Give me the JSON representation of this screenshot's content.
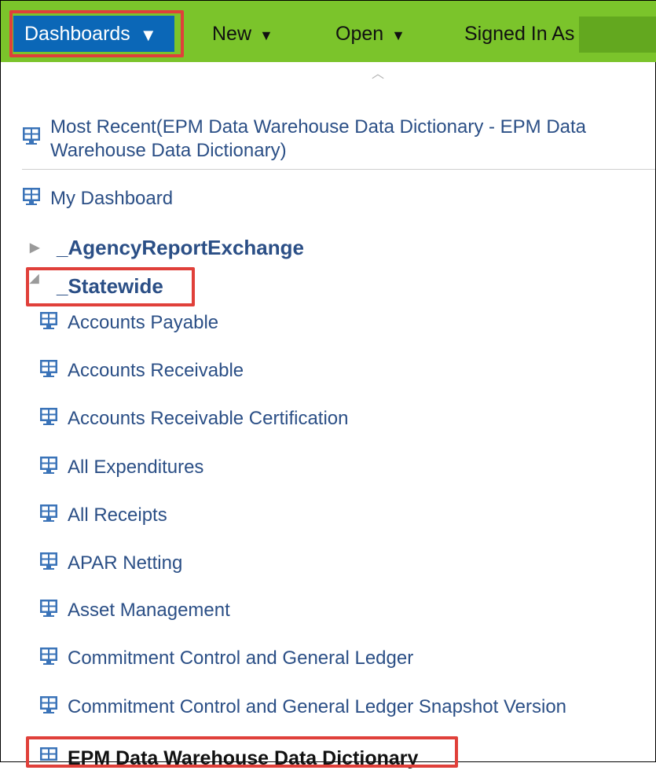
{
  "menubar": {
    "dashboards_label": "Dashboards",
    "new_label": "New",
    "open_label": "Open",
    "signed_in_label": "Signed In As"
  },
  "dropdown": {
    "most_recent": "Most Recent(EPM Data Warehouse Data Dictionary - EPM Data Warehouse Data Dictionary)",
    "my_dashboard": "My Dashboard",
    "folders": [
      {
        "label": "_AgencyReportExchange",
        "expanded": false
      },
      {
        "label": "_Statewide",
        "expanded": true
      }
    ],
    "statewide_items": [
      "Accounts Payable",
      "Accounts Receivable",
      "Accounts Receivable Certification",
      "All Expenditures",
      "All Receipts",
      "APAR Netting",
      "Asset Management",
      "Commitment Control and General Ledger",
      "Commitment Control and General Ledger Snapshot Version"
    ],
    "partial_item": "EPM Data Warehouse Data Dictionary"
  },
  "icons": {
    "menu_arrow": "caret-down-icon",
    "dashboard": "dashboard-icon",
    "scroll_up": "chevron-up-icon",
    "collapsed_folder": "triangle-right-icon",
    "expanded_folder": "triangle-down-icon"
  },
  "colors": {
    "menubar": "#7bc42b",
    "active_menu": "#0b67b7",
    "link_text": "#2b4f86",
    "highlight_box": "#e0403a"
  }
}
